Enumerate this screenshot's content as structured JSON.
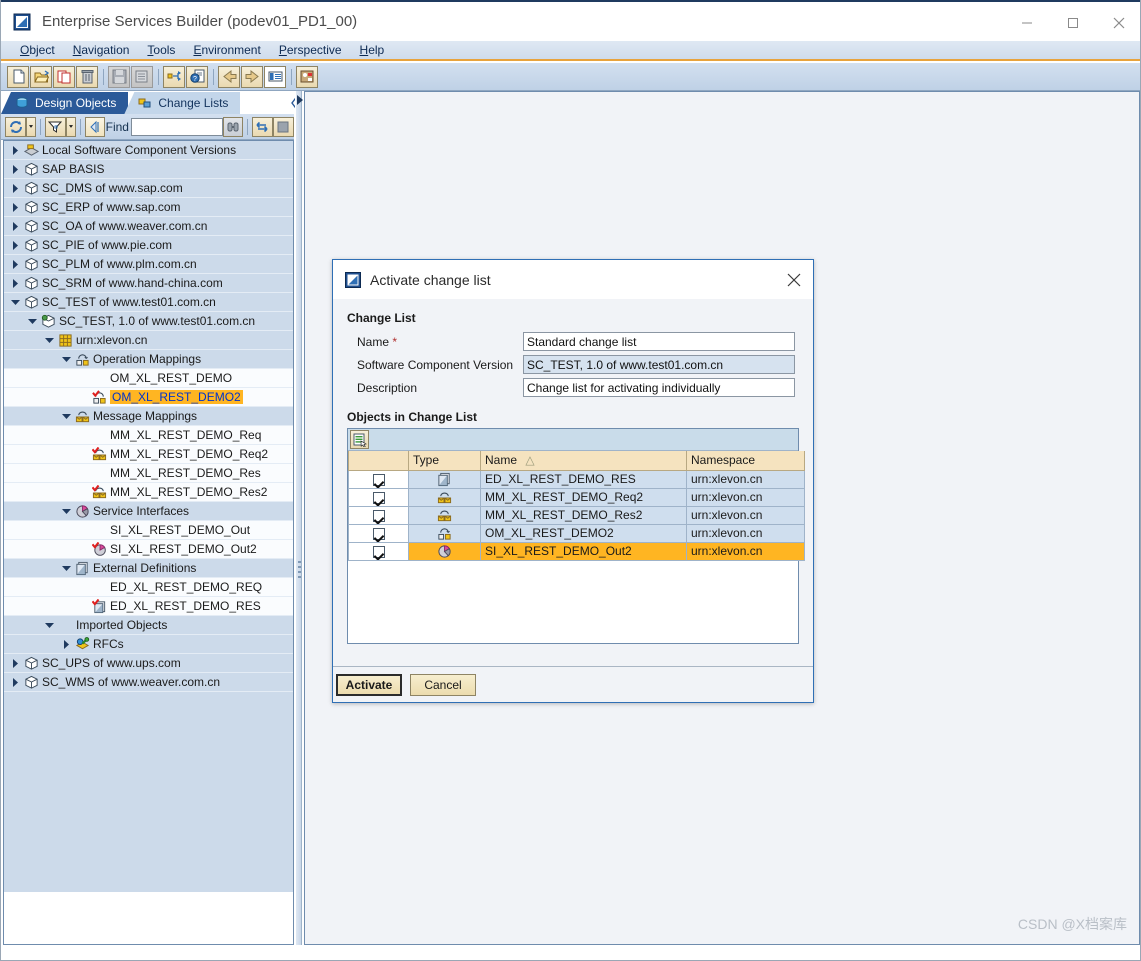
{
  "window": {
    "title": "Enterprise Services Builder (podev01_PD1_00)",
    "app_icon": "app-window-icon",
    "minimize": "—",
    "maximize": "□",
    "close": "✕"
  },
  "menubar": {
    "items": [
      {
        "label": "Object",
        "accel": "O"
      },
      {
        "label": "Navigation",
        "accel": "N"
      },
      {
        "label": "Tools",
        "accel": "T"
      },
      {
        "label": "Environment",
        "accel": "E"
      },
      {
        "label": "Perspective",
        "accel": "P"
      },
      {
        "label": "Help",
        "accel": "H"
      }
    ]
  },
  "toolbar": {
    "buttons": [
      {
        "name": "new-object-button",
        "icon": "new-document-icon",
        "enabled": true
      },
      {
        "name": "open-object-button",
        "icon": "open-folder-icon",
        "enabled": true
      },
      {
        "name": "copy-object-button",
        "icon": "copy-icon",
        "enabled": true
      },
      {
        "name": "delete-object-button",
        "icon": "trash-icon",
        "enabled": true
      },
      {
        "name": "save-button",
        "icon": "save-disk-icon",
        "enabled": false
      },
      {
        "name": "activate-button",
        "icon": "activate-list-icon",
        "enabled": false
      },
      {
        "name": "where-used-button",
        "icon": "where-used-icon",
        "enabled": true
      },
      {
        "name": "check-object-button",
        "icon": "check-document-icon",
        "enabled": true
      },
      {
        "name": "back-button",
        "icon": "arrow-left-icon",
        "enabled": true
      },
      {
        "name": "forward-button",
        "icon": "arrow-right-icon",
        "enabled": true
      },
      {
        "name": "properties-button",
        "icon": "properties-list-icon",
        "enabled": true
      },
      {
        "name": "cache-refresh-button",
        "icon": "cache-icon",
        "enabled": true
      }
    ]
  },
  "tabs": [
    {
      "label": "Design Objects",
      "icon": "design-objects-icon",
      "active": true
    },
    {
      "label": "Change Lists",
      "icon": "change-lists-icon",
      "active": false
    }
  ],
  "findbar": {
    "refresh_icon": "refresh-icon",
    "filter_icon": "filter-icon",
    "scope_icon": "find-scope-icon",
    "find_label": "Find",
    "find_value": "",
    "find_placeholder": "",
    "binoculars_icon": "binoculars-icon",
    "sync_icon": "sync-navigation-icon",
    "stop_icon": "stop-icon"
  },
  "tree": {
    "items": [
      {
        "label": "Local Software Component Versions",
        "depth": 0,
        "twisty": "collapsed",
        "icon": "software-catalog-icon",
        "kind": "folder"
      },
      {
        "label": "SAP BASIS",
        "depth": 0,
        "twisty": "collapsed",
        "icon": "swcv-cube-icon",
        "kind": "folder"
      },
      {
        "label": "SC_DMS of www.sap.com",
        "depth": 0,
        "twisty": "collapsed",
        "icon": "swcv-cube-icon",
        "kind": "folder"
      },
      {
        "label": "SC_ERP of www.sap.com",
        "depth": 0,
        "twisty": "collapsed",
        "icon": "swcv-cube-icon",
        "kind": "folder"
      },
      {
        "label": "SC_OA of www.weaver.com.cn",
        "depth": 0,
        "twisty": "collapsed",
        "icon": "swcv-cube-icon",
        "kind": "folder"
      },
      {
        "label": "SC_PIE of www.pie.com",
        "depth": 0,
        "twisty": "collapsed",
        "icon": "swcv-cube-icon",
        "kind": "folder"
      },
      {
        "label": "SC_PLM of www.plm.com.cn",
        "depth": 0,
        "twisty": "collapsed",
        "icon": "swcv-cube-icon",
        "kind": "folder"
      },
      {
        "label": "SC_SRM of www.hand-china.com",
        "depth": 0,
        "twisty": "collapsed",
        "icon": "swcv-cube-icon",
        "kind": "folder"
      },
      {
        "label": "SC_TEST of www.test01.com.cn",
        "depth": 0,
        "twisty": "expanded",
        "icon": "swcv-cube-icon",
        "kind": "folder"
      },
      {
        "label": "SC_TEST, 1.0 of www.test01.com.cn",
        "depth": 1,
        "twisty": "expanded",
        "icon": "swcv-version-icon",
        "kind": "folder"
      },
      {
        "label": "urn:xlevon.cn",
        "depth": 2,
        "twisty": "expanded",
        "icon": "namespace-icon",
        "kind": "folder"
      },
      {
        "label": "Operation Mappings",
        "depth": 3,
        "twisty": "expanded",
        "icon": "operation-mapping-icon",
        "kind": "folder"
      },
      {
        "label": "OM_XL_REST_DEMO",
        "depth": 4,
        "twisty": "none",
        "icon": "none",
        "kind": "leaf"
      },
      {
        "label": "OM_XL_REST_DEMO2",
        "depth": 4,
        "twisty": "none",
        "icon": "operation-mapping-modified-icon",
        "kind": "leaf",
        "selected": true
      },
      {
        "label": "Message Mappings",
        "depth": 3,
        "twisty": "expanded",
        "icon": "message-mapping-icon",
        "kind": "folder"
      },
      {
        "label": "MM_XL_REST_DEMO_Req",
        "depth": 4,
        "twisty": "none",
        "icon": "none",
        "kind": "leaf"
      },
      {
        "label": "MM_XL_REST_DEMO_Req2",
        "depth": 4,
        "twisty": "none",
        "icon": "message-mapping-modified-icon",
        "kind": "leaf"
      },
      {
        "label": "MM_XL_REST_DEMO_Res",
        "depth": 4,
        "twisty": "none",
        "icon": "none",
        "kind": "leaf"
      },
      {
        "label": "MM_XL_REST_DEMO_Res2",
        "depth": 4,
        "twisty": "none",
        "icon": "message-mapping-modified-icon",
        "kind": "leaf"
      },
      {
        "label": "Service Interfaces",
        "depth": 3,
        "twisty": "expanded",
        "icon": "service-interface-icon",
        "kind": "folder"
      },
      {
        "label": "SI_XL_REST_DEMO_Out",
        "depth": 4,
        "twisty": "none",
        "icon": "none",
        "kind": "leaf"
      },
      {
        "label": "SI_XL_REST_DEMO_Out2",
        "depth": 4,
        "twisty": "none",
        "icon": "service-interface-modified-icon",
        "kind": "leaf"
      },
      {
        "label": "External Definitions",
        "depth": 3,
        "twisty": "expanded",
        "icon": "external-definition-icon",
        "kind": "folder"
      },
      {
        "label": "ED_XL_REST_DEMO_REQ",
        "depth": 4,
        "twisty": "none",
        "icon": "none",
        "kind": "leaf"
      },
      {
        "label": "ED_XL_REST_DEMO_RES",
        "depth": 4,
        "twisty": "none",
        "icon": "external-definition-modified-icon",
        "kind": "leaf"
      },
      {
        "label": "Imported Objects",
        "depth": 2,
        "twisty": "expanded",
        "icon": "none",
        "kind": "folder"
      },
      {
        "label": "RFCs",
        "depth": 3,
        "twisty": "collapsed",
        "icon": "rfc-icon",
        "kind": "folder"
      },
      {
        "label": "SC_UPS of www.ups.com",
        "depth": 0,
        "twisty": "collapsed",
        "icon": "swcv-cube-icon",
        "kind": "folder"
      },
      {
        "label": "SC_WMS of www.weaver.com.cn",
        "depth": 0,
        "twisty": "collapsed",
        "icon": "swcv-cube-icon",
        "kind": "folder"
      }
    ]
  },
  "dialog": {
    "title": "Activate change list",
    "title_icon": "app-window-icon",
    "close_icon": "close-icon",
    "group_title": "Change List",
    "fields": [
      {
        "label": "Name",
        "required": true,
        "value": "Standard change list",
        "readonly": false
      },
      {
        "label": "Software Component Version",
        "required": false,
        "value": "SC_TEST, 1.0 of www.test01.com.cn",
        "readonly": true
      },
      {
        "label": "Description",
        "required": false,
        "value": "Change list for activating individually",
        "readonly": false
      }
    ],
    "objects_title": "Objects in Change List",
    "table_toolbar_icon": "open-object-detail-icon",
    "table": {
      "columns": [
        "",
        "Type",
        "Name",
        "Namespace"
      ],
      "sort_column": "Name",
      "sort_direction": "ascending",
      "rows": [
        {
          "checked": true,
          "type_icon": "external-definition-icon",
          "name": "ED_XL_REST_DEMO_RES",
          "namespace": "urn:xlevon.cn",
          "highlighted": false
        },
        {
          "checked": true,
          "type_icon": "message-mapping-icon",
          "name": "MM_XL_REST_DEMO_Req2",
          "namespace": "urn:xlevon.cn",
          "highlighted": false
        },
        {
          "checked": true,
          "type_icon": "message-mapping-icon",
          "name": "MM_XL_REST_DEMO_Res2",
          "namespace": "urn:xlevon.cn",
          "highlighted": false
        },
        {
          "checked": true,
          "type_icon": "operation-mapping-icon",
          "name": "OM_XL_REST_DEMO2",
          "namespace": "urn:xlevon.cn",
          "highlighted": false
        },
        {
          "checked": true,
          "type_icon": "service-interface-icon",
          "name": "SI_XL_REST_DEMO_Out2",
          "namespace": "urn:xlevon.cn",
          "highlighted": true
        }
      ]
    },
    "buttons": [
      {
        "label": "Activate",
        "default": true
      },
      {
        "label": "Cancel",
        "default": false
      }
    ]
  },
  "watermark": "CSDN @X档案库",
  "colors": {
    "accent_orange": "#e8a33d",
    "selection_orange": "#ffb522",
    "selection_text_blue": "#0033cc",
    "tab_active_blue": "#2b5a99",
    "dialog_border_blue": "#2f6fb5",
    "tree_row_blue": "#ccdaea",
    "table_header_tan": "#f5e3bf"
  }
}
